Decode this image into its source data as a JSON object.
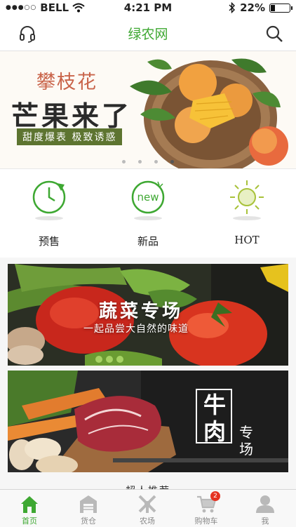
{
  "status_bar": {
    "carrier": "BELL",
    "time": "4:21 PM",
    "battery_percent": "22%",
    "battery_level": 0.22
  },
  "nav": {
    "title": "绿农网",
    "left_icon": "headset-icon",
    "right_icon": "search-icon"
  },
  "banner": {
    "small_title": "攀枝花",
    "big_title": "芒果来了",
    "tagline": "甜度爆表 极致诱惑",
    "slide_count": 4,
    "active_slide": 4
  },
  "shortcuts": [
    {
      "label": "预售",
      "icon": "clock-icon"
    },
    {
      "label": "新品",
      "icon": "new-badge-icon"
    },
    {
      "label": "HOT",
      "icon": "sun-icon"
    }
  ],
  "categories": {
    "vegetables": {
      "title": "蔬菜专场",
      "subtitle": "一起品尝大自然的味道"
    },
    "beef": {
      "title_line1": "牛",
      "title_line2": "肉",
      "subtitle": "专场"
    }
  },
  "section_peek": "超人推荐",
  "tab_bar": [
    {
      "label": "首页",
      "icon": "home-icon",
      "active": true
    },
    {
      "label": "货仓",
      "icon": "warehouse-icon",
      "active": false
    },
    {
      "label": "农场",
      "icon": "farm-icon",
      "active": false
    },
    {
      "label": "购物车",
      "icon": "cart-icon",
      "active": false,
      "badge": "2"
    },
    {
      "label": "我",
      "icon": "user-icon",
      "active": false
    }
  ],
  "colors": {
    "brand_green": "#3ea832",
    "badge_red": "#e53322",
    "banner_tag": "#5d7430"
  }
}
